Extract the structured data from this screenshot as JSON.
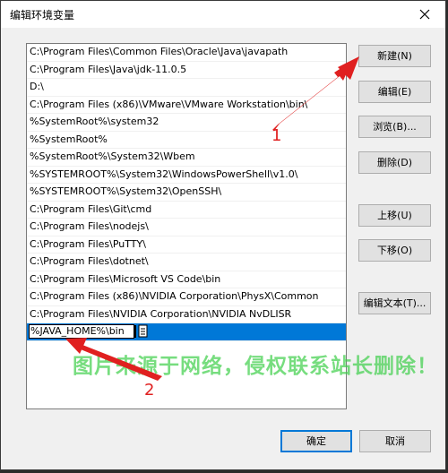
{
  "window": {
    "title": "编辑环境变量",
    "close_glyph": "✕"
  },
  "path_list": {
    "items": [
      "C:\\Program Files\\Common Files\\Oracle\\Java\\javapath",
      "C:\\Program Files\\Java\\jdk-11.0.5",
      "D:\\",
      "C:\\Program Files (x86)\\VMware\\VMware Workstation\\bin\\",
      "%SystemRoot%\\system32",
      "%SystemRoot%",
      "%SystemRoot%\\System32\\Wbem",
      "%SYSTEMROOT%\\System32\\WindowsPowerShell\\v1.0\\",
      "%SYSTEMROOT%\\System32\\OpenSSH\\",
      "C:\\Program Files\\Git\\cmd",
      "C:\\Program Files\\nodejs\\",
      "C:\\Program Files\\PuTTY\\",
      "C:\\Program Files\\dotnet\\",
      "C:\\Program Files\\Microsoft VS Code\\bin",
      "C:\\Program Files (x86)\\NVIDIA Corporation\\PhysX\\Common",
      "C:\\Program Files\\NVIDIA Corporation\\NVIDIA NvDLISR"
    ],
    "editing_value": "%JAVA_HOME%\\bin"
  },
  "buttons": {
    "new": "新建(N)",
    "edit": "编辑(E)",
    "browse": "浏览(B)...",
    "delete": "删除(D)",
    "move_up": "上移(U)",
    "move_down": "下移(O)",
    "edit_text": "编辑文本(T)...",
    "ok": "确定",
    "cancel": "取消"
  },
  "annotations": {
    "label_1": "1",
    "label_2": "2",
    "arrow_color": "#e02020"
  },
  "watermark": "图片来源于网络，侵权联系站长删除！",
  "colors": {
    "selection": "#0078d7",
    "window_bg": "#f0f0f0",
    "watermark": "#3ecf4a"
  }
}
